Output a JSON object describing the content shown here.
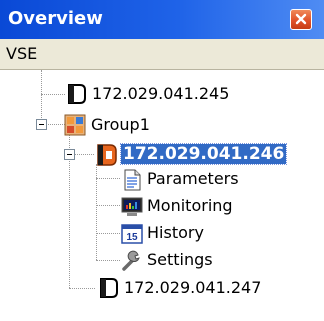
{
  "window": {
    "title": "Overview"
  },
  "tree": {
    "root_label": "VSE",
    "nodes": [
      {
        "label": "172.029.041.245"
      },
      {
        "label": "Group1"
      },
      {
        "label": "172.029.041.246"
      },
      {
        "label": "Parameters"
      },
      {
        "label": "Monitoring"
      },
      {
        "label": "History"
      },
      {
        "label": "Settings"
      },
      {
        "label": "172.029.041.247"
      }
    ],
    "history_icon_text": "15",
    "selected_index": 2
  },
  "colors": {
    "titlebar": "#1f63e8",
    "selection": "#316ac5",
    "close_button": "#e0522a",
    "header_row": "#ece9d8"
  }
}
